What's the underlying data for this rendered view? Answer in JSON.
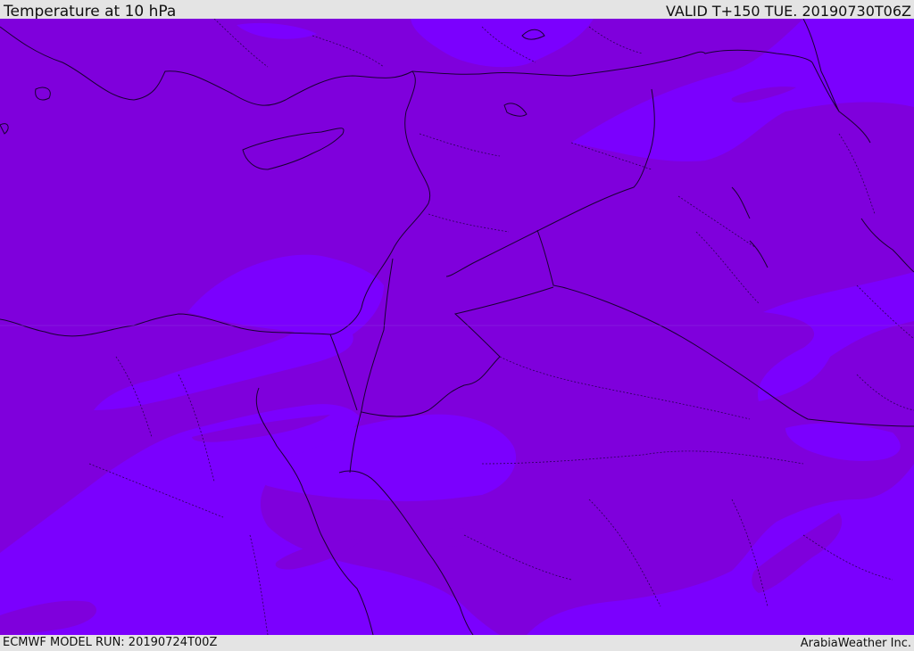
{
  "header": {
    "title": "Temperature at 10 hPa",
    "valid_time": "VALID T+150 TUE. 20190730T06Z"
  },
  "footer": {
    "model_run": "ECMWF MODEL RUN: 20190724T00Z",
    "credit": "ArabiaWeather Inc."
  },
  "colors": {
    "background_field": "#7f00dc",
    "warm_band": "#7b00fe",
    "coastline": "#1a0033",
    "borders": "#2a0055",
    "bars": "#e4e4e4"
  }
}
